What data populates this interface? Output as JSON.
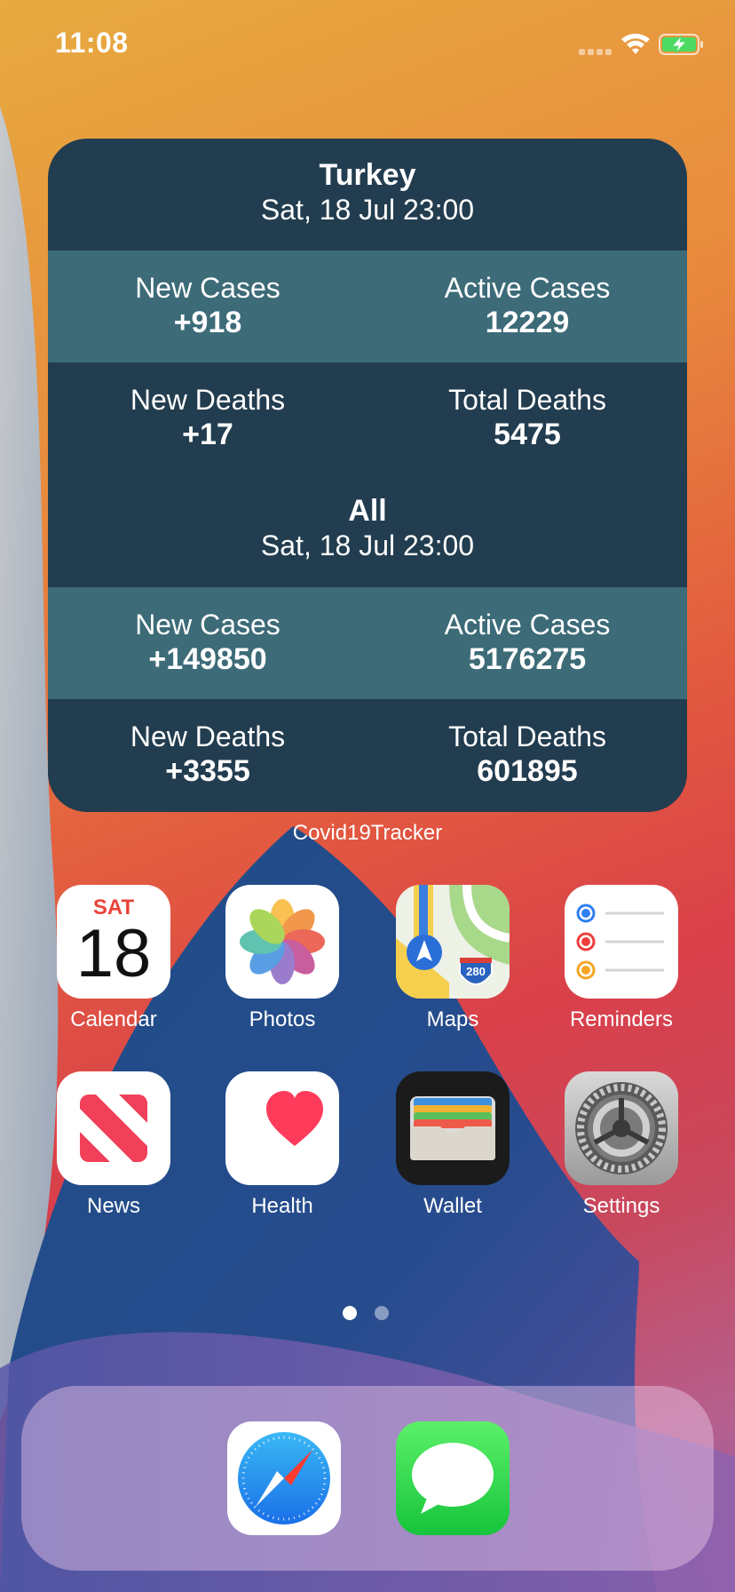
{
  "status_bar": {
    "time": "11:08"
  },
  "widget": {
    "sections": [
      {
        "title": "Turkey",
        "date": "Sat, 18 Jul 23:00",
        "new_cases_label": "New Cases",
        "new_cases_value": "+918",
        "active_cases_label": "Active Cases",
        "active_cases_value": "12229",
        "new_deaths_label": "New Deaths",
        "new_deaths_value": "+17",
        "total_deaths_label": "Total Deaths",
        "total_deaths_value": "5475"
      },
      {
        "title": "All",
        "date": "Sat, 18 Jul 23:00",
        "new_cases_label": "New Cases",
        "new_cases_value": "+149850",
        "active_cases_label": "Active Cases",
        "active_cases_value": "5176275",
        "new_deaths_label": "New Deaths",
        "new_deaths_value": "+3355",
        "total_deaths_label": "Total Deaths",
        "total_deaths_value": "601895"
      }
    ],
    "app_name": "Covid19Tracker"
  },
  "apps": [
    {
      "label": "Calendar",
      "icon": "calendar-icon",
      "day_label": "SAT",
      "day_number": "18"
    },
    {
      "label": "Photos",
      "icon": "photos-icon"
    },
    {
      "label": "Maps",
      "icon": "maps-icon",
      "badge": "280"
    },
    {
      "label": "Reminders",
      "icon": "reminders-icon"
    },
    {
      "label": "News",
      "icon": "news-icon"
    },
    {
      "label": "Health",
      "icon": "health-icon"
    },
    {
      "label": "Wallet",
      "icon": "wallet-icon"
    },
    {
      "label": "Settings",
      "icon": "settings-icon"
    }
  ],
  "dock": [
    {
      "name": "Safari",
      "icon": "safari-icon"
    },
    {
      "name": "Messages",
      "icon": "messages-icon"
    }
  ],
  "page_indicator": {
    "pages": 2,
    "current": 1
  },
  "colors": {
    "widget_bg": "#223d4f",
    "widget_band": "#3d6b78",
    "battery_green": "#4cd964"
  }
}
